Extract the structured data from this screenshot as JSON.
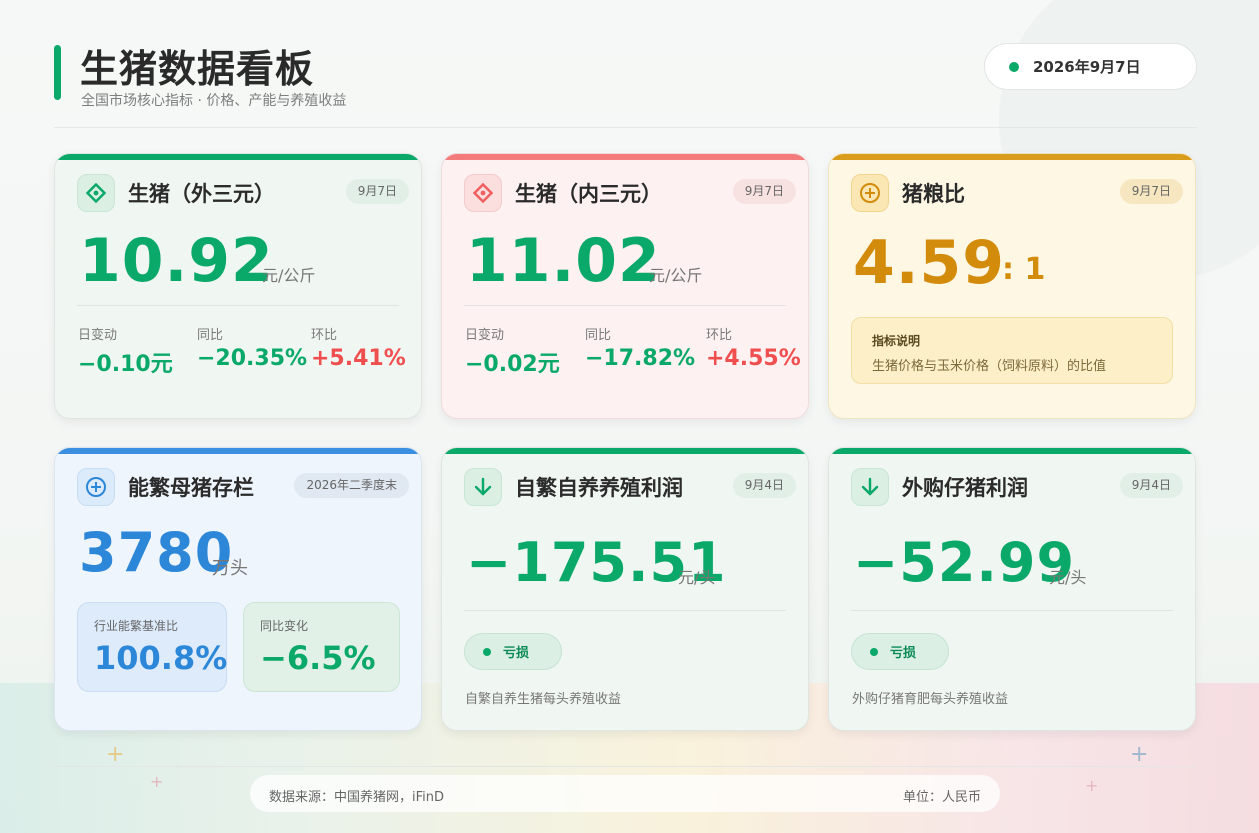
{
  "header": {
    "title": "生猪数据看板",
    "subtitle": "全国市场核心指标 · 价格、产能与养殖收益",
    "date": "2026年9月7日"
  },
  "colors": {
    "green": "#0aa869",
    "red": "#ef4f4f",
    "gold": "#d38b0c",
    "blue": "#2d87d8"
  },
  "cards": {
    "outer": {
      "icon": "diamond-icon",
      "title": "生猪（外三元）",
      "date": "9月7日",
      "value": "10.92",
      "unit": "元/公斤",
      "stats": [
        {
          "label": "日变动",
          "value": "−0.10元"
        },
        {
          "label": "同比",
          "value": "−20.35%"
        },
        {
          "label": "环比",
          "value": "+5.41%"
        }
      ]
    },
    "inner": {
      "icon": "diamond-icon",
      "title": "生猪（内三元）",
      "date": "9月7日",
      "value": "11.02",
      "unit": "元/公斤",
      "stats": [
        {
          "label": "日变动",
          "value": "−0.02元"
        },
        {
          "label": "同比",
          "value": "−17.82%"
        },
        {
          "label": "环比",
          "value": "+4.55%"
        }
      ]
    },
    "ratio": {
      "icon": "plus-circle-icon",
      "title": "猪粮比",
      "date": "9月7日",
      "value": "4.59",
      "suffix": ": 1",
      "info_title": "指标说明",
      "info_text": "生猪价格与玉米价格（饲料原料）的比值"
    },
    "sow": {
      "icon": "plus-circle-icon",
      "title": "能繁母猪存栏",
      "date": "2026年二季度末",
      "value": "3780",
      "unit": "万头",
      "box1_label": "行业能繁基准比",
      "box1_value": "100.8%",
      "box2_label": "同比变化",
      "box2_value": "−6.5%"
    },
    "self": {
      "icon": "arrow-down-icon",
      "title": "自繁自养养殖利润",
      "date": "9月4日",
      "value": "−175.51",
      "unit": "元/头",
      "status": "亏损",
      "note": "自繁自养生猪每头养殖收益"
    },
    "bought": {
      "icon": "arrow-down-icon",
      "title": "外购仔猪利润",
      "date": "9月4日",
      "value": "−52.99",
      "unit": "元/头",
      "status": "亏损",
      "note": "外购仔猪育肥每头养殖收益"
    }
  },
  "footer": {
    "source": "数据来源：中国养猪网，iFinD",
    "unit": "单位：人民币"
  }
}
